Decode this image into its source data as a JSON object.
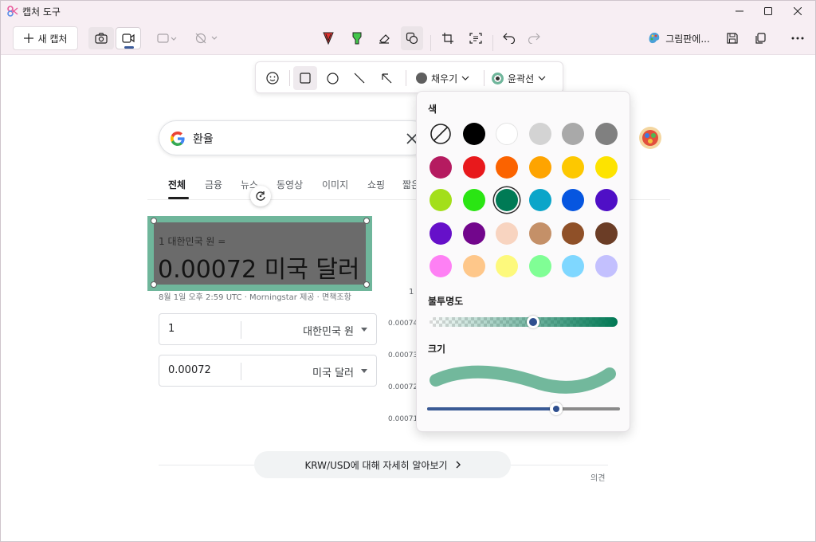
{
  "window": {
    "title": "캡처 도구"
  },
  "toolbar": {
    "new_capture_label": "새 캡처",
    "paint_label": "그림판에..."
  },
  "shape_bar": {
    "fill_label": "채우기",
    "outline_label": "윤곽선",
    "fill_color": "#5f5f5f",
    "outline_color": "#6fb69b"
  },
  "search": {
    "query": "환율"
  },
  "tabs": [
    "전체",
    "금융",
    "뉴스",
    "동영상",
    "이미지",
    "쇼핑",
    "짧은"
  ],
  "result": {
    "conversion_label": "1 대한민국 원 =",
    "conversion_value": "0.00072 미국 달러",
    "source": "8월 1일 오후 2:59 UTC · Morningstar 제공 · 면책조항"
  },
  "converter": [
    {
      "amount": "1",
      "currency": "대한민국 원"
    },
    {
      "amount": "0.00072",
      "currency": "미국 달러"
    }
  ],
  "chart_axis": {
    "top_fragment": "1",
    "labels": [
      "0.00074",
      "0.00073",
      "0.00072",
      "0.00071"
    ]
  },
  "footer": {
    "more_label": "KRW/USD에 대해 자세히 알아보기",
    "feedback": "의견"
  },
  "color_panel": {
    "color_heading": "색",
    "opacity_heading": "불투명도",
    "size_heading": "크기",
    "opacity": 0.55,
    "size": 0.67,
    "selected_color": "#007a55",
    "colors": [
      [
        "none",
        "#000000",
        "#ffffff",
        "#d3d3d3",
        "#a9a9a9",
        "#808080"
      ],
      [
        "#b51b60",
        "#e8191c",
        "#fb6300",
        "#fea400",
        "#fdc800",
        "#fde300"
      ],
      [
        "#a3df1a",
        "#2ae513",
        "#007a55",
        "#0ba5c9",
        "#0656e0",
        "#4f0fc6"
      ],
      [
        "#6610c9",
        "#72068c",
        "#f8d4c0",
        "#c49068",
        "#8f5028",
        "#6b3d26"
      ],
      [
        "#fe80f4",
        "#fec78a",
        "#fdf97c",
        "#80fe95",
        "#7fd7ff",
        "#c3c0fe"
      ]
    ]
  }
}
